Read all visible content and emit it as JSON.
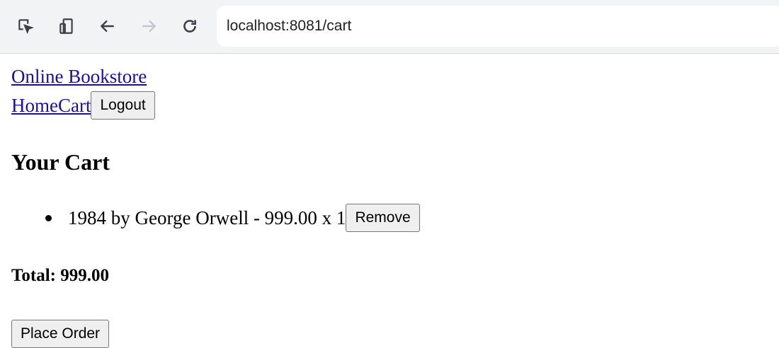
{
  "browser": {
    "url": "localhost:8081/cart",
    "icons": [
      "inspect-icon",
      "device-toggle-icon",
      "back-arrow-icon",
      "forward-arrow-icon",
      "reload-icon"
    ]
  },
  "site": {
    "brand": "Online Bookstore",
    "nav": {
      "home": "Home",
      "cart": "Cart",
      "logout": "Logout"
    }
  },
  "cart": {
    "heading": "Your Cart",
    "items": [
      {
        "text": "1984 by George Orwell - 999.00 x 1",
        "remove_label": "Remove"
      }
    ],
    "total_text": "Total: 999.00",
    "place_order_label": "Place Order"
  },
  "colors": {
    "link": "#1a0dab",
    "toolbar_bg": "#f1f3f4",
    "button_bg": "#efefef"
  }
}
